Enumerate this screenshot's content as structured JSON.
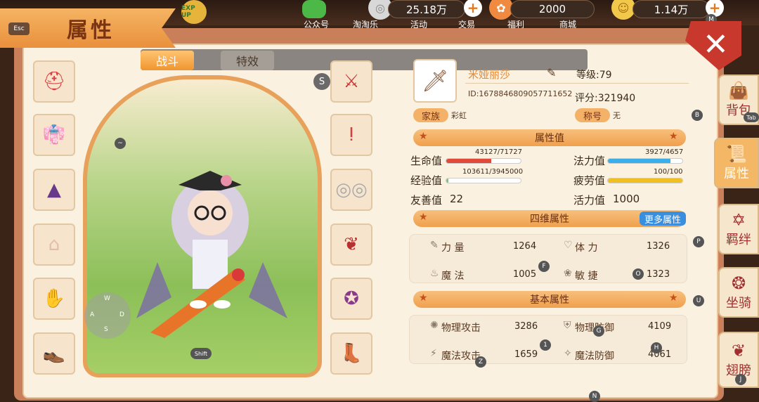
{
  "window": {
    "title": "属性",
    "esc_key": "Esc",
    "close_symbol": "✕"
  },
  "top_bar": {
    "resources": [
      {
        "name": "silver",
        "value": "25.18万"
      },
      {
        "name": "paw",
        "value": "2000"
      },
      {
        "name": "gold",
        "value": "1.14万"
      }
    ],
    "menu": [
      "公众号",
      "淘淘乐",
      "活动",
      "交易",
      "福利",
      "商城"
    ],
    "exp_up_label": "EXP UP",
    "key_hint_m": "M"
  },
  "tabs": [
    {
      "label": "战斗",
      "active": true
    },
    {
      "label": "特效",
      "active": false
    }
  ],
  "equipment": {
    "left": [
      "helmet-icon",
      "armor-icon",
      "skirt-icon",
      "cape-icon",
      "gloves-icon",
      "shoes-icon"
    ],
    "right": [
      "weapon-icon",
      "necklace-icon",
      "glasses-icon",
      "wing-icon",
      "badge-icon",
      "boots-icon"
    ],
    "s_badge": "S"
  },
  "character": {
    "joystick_keys": [
      "W",
      "A",
      "S",
      "D"
    ],
    "shift_key": "Shift",
    "tilde_key": "~"
  },
  "profile": {
    "name": "米娅丽莎",
    "id": "ID:1678846809057711652",
    "level": "等级:79",
    "score": "评分:321940",
    "family_label": "家族",
    "family_value": "彩虹",
    "title_label": "称号",
    "title_value": "无",
    "key_b": "B"
  },
  "attr_values": {
    "header": "属性值",
    "hp": {
      "label": "生命值",
      "text": "43127/71727",
      "ratio": 0.601
    },
    "mp": {
      "label": "法力值",
      "text": "3927/4657",
      "ratio": 0.843
    },
    "exp": {
      "label": "经验值",
      "text": "103611/3945000",
      "ratio": 0.026
    },
    "fatigue": {
      "label": "疲劳值",
      "text": "100/100",
      "ratio": 1.0
    },
    "friendly": {
      "label": "友善值",
      "value": "22"
    },
    "vitality": {
      "label": "活力值",
      "value": "1000"
    }
  },
  "four_dim": {
    "header": "四维属性",
    "more_button": "更多属性",
    "items": [
      {
        "label": "力 量",
        "value": "1264"
      },
      {
        "label": "体 力",
        "value": "1326"
      },
      {
        "label": "魔 法",
        "value": "1005"
      },
      {
        "label": "敏 捷",
        "value": "1323"
      }
    ],
    "keys": [
      "P",
      "F",
      "O"
    ]
  },
  "basic": {
    "header": "基本属性",
    "items": [
      {
        "label": "物理攻击",
        "value": "3286"
      },
      {
        "label": "物理防御",
        "value": "4109"
      },
      {
        "label": "魔法攻击",
        "value": "1659"
      },
      {
        "label": "魔法防御",
        "value": "4061"
      }
    ],
    "keys": [
      "U",
      "G",
      "1",
      "H",
      "Z",
      "N"
    ]
  },
  "side_nav": [
    {
      "label": "背包",
      "key": "Tab"
    },
    {
      "label": "属性",
      "active": true
    },
    {
      "label": "羁绊"
    },
    {
      "label": "坐骑"
    },
    {
      "label": "翅膀",
      "key": "J"
    }
  ],
  "colors": {
    "hp": "#e04a3a",
    "mp": "#3aaee8",
    "exp": "#7ac870",
    "fatigue": "#f0c020",
    "accent": "#f0962f"
  }
}
